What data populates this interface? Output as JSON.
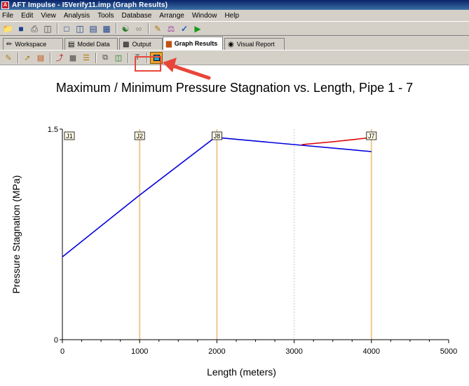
{
  "window": {
    "title": "AFT Impulse - I5Verify11.imp (Graph Results)",
    "app_icon": "aft-app-icon"
  },
  "menubar": {
    "items": [
      "File",
      "Edit",
      "View",
      "Analysis",
      "Tools",
      "Database",
      "Arrange",
      "Window",
      "Help"
    ]
  },
  "toolbar": {
    "icons": [
      "open-folder-icon",
      "save-icon",
      "print-icon",
      "print-preview-icon",
      "window-layout-icon",
      "tile-vertical-icon",
      "tile-horizontal-icon",
      "cascade-icon",
      "network-icon",
      "link-icon",
      "edit-icon",
      "flask-icon",
      "check-icon",
      "run-icon"
    ]
  },
  "tabs": [
    {
      "label": "Workspace",
      "icon": "workspace-icon",
      "active": false
    },
    {
      "label": "Model Data",
      "icon": "model-data-icon",
      "active": false
    },
    {
      "label": "Output",
      "icon": "output-icon",
      "active": false
    },
    {
      "label": "Graph Results",
      "icon": "graph-results-icon",
      "active": true
    },
    {
      "label": "Visual Report",
      "icon": "visual-report-icon",
      "active": false
    }
  ],
  "graph_toolbar": {
    "icons": [
      "graph-edit-icon",
      "graph-control-icon",
      "graph-list-icon",
      "graph-series-icon",
      "table-icon",
      "legend-icon",
      "copy-icon",
      "export-icon",
      "text-icon",
      "highlighted-graph-icon"
    ]
  },
  "annotation": {
    "highlight_color": "#e8463a"
  },
  "chart_data": {
    "type": "line",
    "title": "Maximum / Minimum Pressure Stagnation vs. Length, Pipe 1 - 7",
    "xlabel": "Length (meters)",
    "ylabel": "Pressure Stagnation (MPa)",
    "xlim": [
      0,
      5000
    ],
    "ylim": [
      0,
      1.5
    ],
    "x_ticks": [
      "0",
      "1000",
      "2000",
      "3000",
      "4000",
      "5000"
    ],
    "y_ticks": [
      "0",
      "1.5"
    ],
    "junctions": [
      {
        "label": "J1",
        "x": 0
      },
      {
        "label": "J2",
        "x": 1000
      },
      {
        "label": "J8",
        "x": 2000
      },
      {
        "label": "J7",
        "x": 4000
      }
    ],
    "series": [
      {
        "color": "#0000dd",
        "points": [
          [
            0,
            0.59
          ],
          [
            1000,
            1.03
          ],
          [
            1950,
            1.43
          ],
          [
            2000,
            1.44
          ],
          [
            3000,
            1.39
          ],
          [
            4000,
            1.34
          ]
        ]
      },
      {
        "color": "#dd0000",
        "points": [
          [
            3100,
            1.39
          ],
          [
            3500,
            1.41
          ],
          [
            4000,
            1.44
          ]
        ]
      }
    ],
    "extra_gridline_x": 3000,
    "junction_line_color": "#f0c890"
  }
}
